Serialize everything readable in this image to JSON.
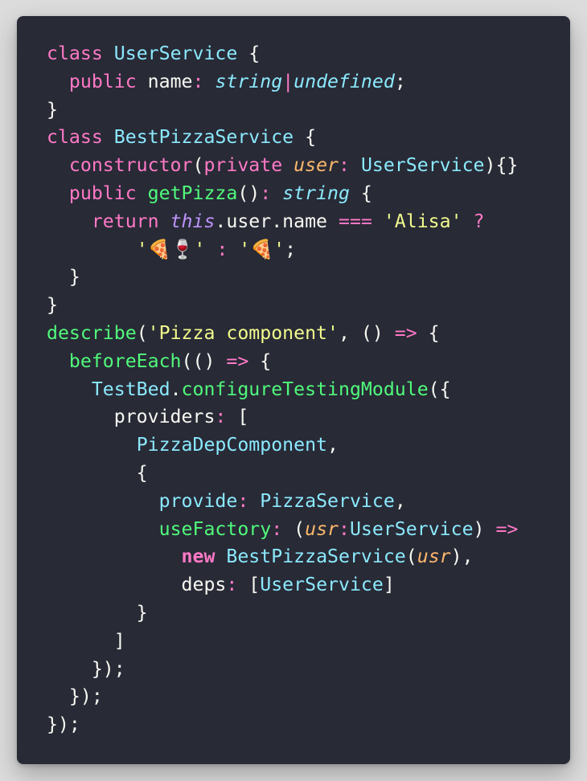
{
  "code_lines": [
    [
      {
        "t": "class",
        "c": "pink"
      },
      {
        "t": " ",
        "c": "white"
      },
      {
        "t": "UserService",
        "c": "cyan"
      },
      {
        "t": " {",
        "c": "white"
      }
    ],
    [
      {
        "t": "  ",
        "c": "white"
      },
      {
        "t": "public",
        "c": "pink"
      },
      {
        "t": " name",
        "c": "white"
      },
      {
        "t": ":",
        "c": "pink"
      },
      {
        "t": " ",
        "c": "white"
      },
      {
        "t": "string",
        "c": "cyan",
        "i": true
      },
      {
        "t": "|",
        "c": "pink"
      },
      {
        "t": "undefined",
        "c": "cyan",
        "i": true
      },
      {
        "t": ";",
        "c": "white"
      }
    ],
    [
      {
        "t": "}",
        "c": "white"
      }
    ],
    [
      {
        "t": "class",
        "c": "pink"
      },
      {
        "t": " ",
        "c": "white"
      },
      {
        "t": "BestPizzaService",
        "c": "cyan"
      },
      {
        "t": " {",
        "c": "white"
      }
    ],
    [
      {
        "t": "  ",
        "c": "white"
      },
      {
        "t": "constructor",
        "c": "pink"
      },
      {
        "t": "(",
        "c": "white"
      },
      {
        "t": "private",
        "c": "pink"
      },
      {
        "t": " ",
        "c": "white"
      },
      {
        "t": "user",
        "c": "orange",
        "i": true
      },
      {
        "t": ":",
        "c": "pink"
      },
      {
        "t": " ",
        "c": "white"
      },
      {
        "t": "UserService",
        "c": "cyan"
      },
      {
        "t": "){}",
        "c": "white"
      }
    ],
    [
      {
        "t": "  ",
        "c": "white"
      },
      {
        "t": "public",
        "c": "pink"
      },
      {
        "t": " ",
        "c": "white"
      },
      {
        "t": "getPizza",
        "c": "green"
      },
      {
        "t": "()",
        "c": "white"
      },
      {
        "t": ":",
        "c": "pink"
      },
      {
        "t": " ",
        "c": "white"
      },
      {
        "t": "string",
        "c": "cyan",
        "i": true
      },
      {
        "t": " {",
        "c": "white"
      }
    ],
    [
      {
        "t": "    ",
        "c": "white"
      },
      {
        "t": "return",
        "c": "pink"
      },
      {
        "t": " ",
        "c": "white"
      },
      {
        "t": "this",
        "c": "purple",
        "i": true
      },
      {
        "t": ".user.name ",
        "c": "white"
      },
      {
        "t": "===",
        "c": "pink"
      },
      {
        "t": " ",
        "c": "white"
      },
      {
        "t": "'Alisa'",
        "c": "yellow"
      },
      {
        "t": " ",
        "c": "white"
      },
      {
        "t": "?",
        "c": "pink"
      }
    ],
    [
      {
        "t": "        ",
        "c": "white"
      },
      {
        "t": "'🍕🍷'",
        "c": "yellow",
        "e": true
      },
      {
        "t": " ",
        "c": "white"
      },
      {
        "t": ":",
        "c": "pink"
      },
      {
        "t": " ",
        "c": "white"
      },
      {
        "t": "'🍕'",
        "c": "yellow",
        "e": true
      },
      {
        "t": ";",
        "c": "white"
      }
    ],
    [
      {
        "t": "  }",
        "c": "white"
      }
    ],
    [
      {
        "t": "}",
        "c": "white"
      }
    ],
    [
      {
        "t": "describe",
        "c": "green"
      },
      {
        "t": "(",
        "c": "white"
      },
      {
        "t": "'Pizza component'",
        "c": "yellow"
      },
      {
        "t": ", () ",
        "c": "white"
      },
      {
        "t": "=>",
        "c": "pink"
      },
      {
        "t": " {",
        "c": "white"
      }
    ],
    [
      {
        "t": "  ",
        "c": "white"
      },
      {
        "t": "beforeEach",
        "c": "green"
      },
      {
        "t": "(() ",
        "c": "white"
      },
      {
        "t": "=>",
        "c": "pink"
      },
      {
        "t": " {",
        "c": "white"
      }
    ],
    [
      {
        "t": "    ",
        "c": "white"
      },
      {
        "t": "TestBed",
        "c": "cyan"
      },
      {
        "t": ".",
        "c": "white"
      },
      {
        "t": "configureTestingModule",
        "c": "green"
      },
      {
        "t": "({",
        "c": "white"
      }
    ],
    [
      {
        "t": "      providers",
        "c": "white"
      },
      {
        "t": ":",
        "c": "pink"
      },
      {
        "t": " [",
        "c": "white"
      }
    ],
    [
      {
        "t": "        ",
        "c": "white"
      },
      {
        "t": "PizzaDepComponent",
        "c": "cyan"
      },
      {
        "t": ",",
        "c": "white"
      }
    ],
    [
      {
        "t": "        {",
        "c": "white"
      }
    ],
    [
      {
        "t": "          ",
        "c": "white"
      },
      {
        "t": "provide",
        "c": "cyan"
      },
      {
        "t": ":",
        "c": "pink"
      },
      {
        "t": " ",
        "c": "white"
      },
      {
        "t": "PizzaService",
        "c": "cyan"
      },
      {
        "t": ",",
        "c": "white"
      }
    ],
    [
      {
        "t": "          ",
        "c": "white"
      },
      {
        "t": "useFactory",
        "c": "green"
      },
      {
        "t": ":",
        "c": "pink"
      },
      {
        "t": " (",
        "c": "white"
      },
      {
        "t": "usr",
        "c": "orange",
        "i": true
      },
      {
        "t": ":",
        "c": "pink"
      },
      {
        "t": "UserService",
        "c": "cyan"
      },
      {
        "t": ") ",
        "c": "white"
      },
      {
        "t": "=>",
        "c": "pink"
      }
    ],
    [
      {
        "t": "            ",
        "c": "white"
      },
      {
        "t": "new",
        "c": "pink",
        "b": true
      },
      {
        "t": " ",
        "c": "white"
      },
      {
        "t": "BestPizzaService",
        "c": "cyan"
      },
      {
        "t": "(",
        "c": "white"
      },
      {
        "t": "usr",
        "c": "orange",
        "i": true
      },
      {
        "t": "),",
        "c": "white"
      }
    ],
    [
      {
        "t": "            deps",
        "c": "white"
      },
      {
        "t": ":",
        "c": "pink"
      },
      {
        "t": " [",
        "c": "white"
      },
      {
        "t": "UserService",
        "c": "cyan"
      },
      {
        "t": "]",
        "c": "white"
      }
    ],
    [
      {
        "t": "        }",
        "c": "white"
      }
    ],
    [
      {
        "t": "      ]",
        "c": "white"
      }
    ],
    [
      {
        "t": "    });",
        "c": "white"
      }
    ],
    [
      {
        "t": "  });",
        "c": "white"
      }
    ],
    [
      {
        "t": "});",
        "c": "white"
      }
    ]
  ],
  "theme_colors": {
    "background": "#282a36",
    "pink": "#ff79c6",
    "cyan": "#8be9fd",
    "green": "#50fa7b",
    "yellow": "#f1fa8c",
    "orange": "#ffb86c",
    "purple": "#bd93f9",
    "foreground": "#f8f8f2"
  }
}
